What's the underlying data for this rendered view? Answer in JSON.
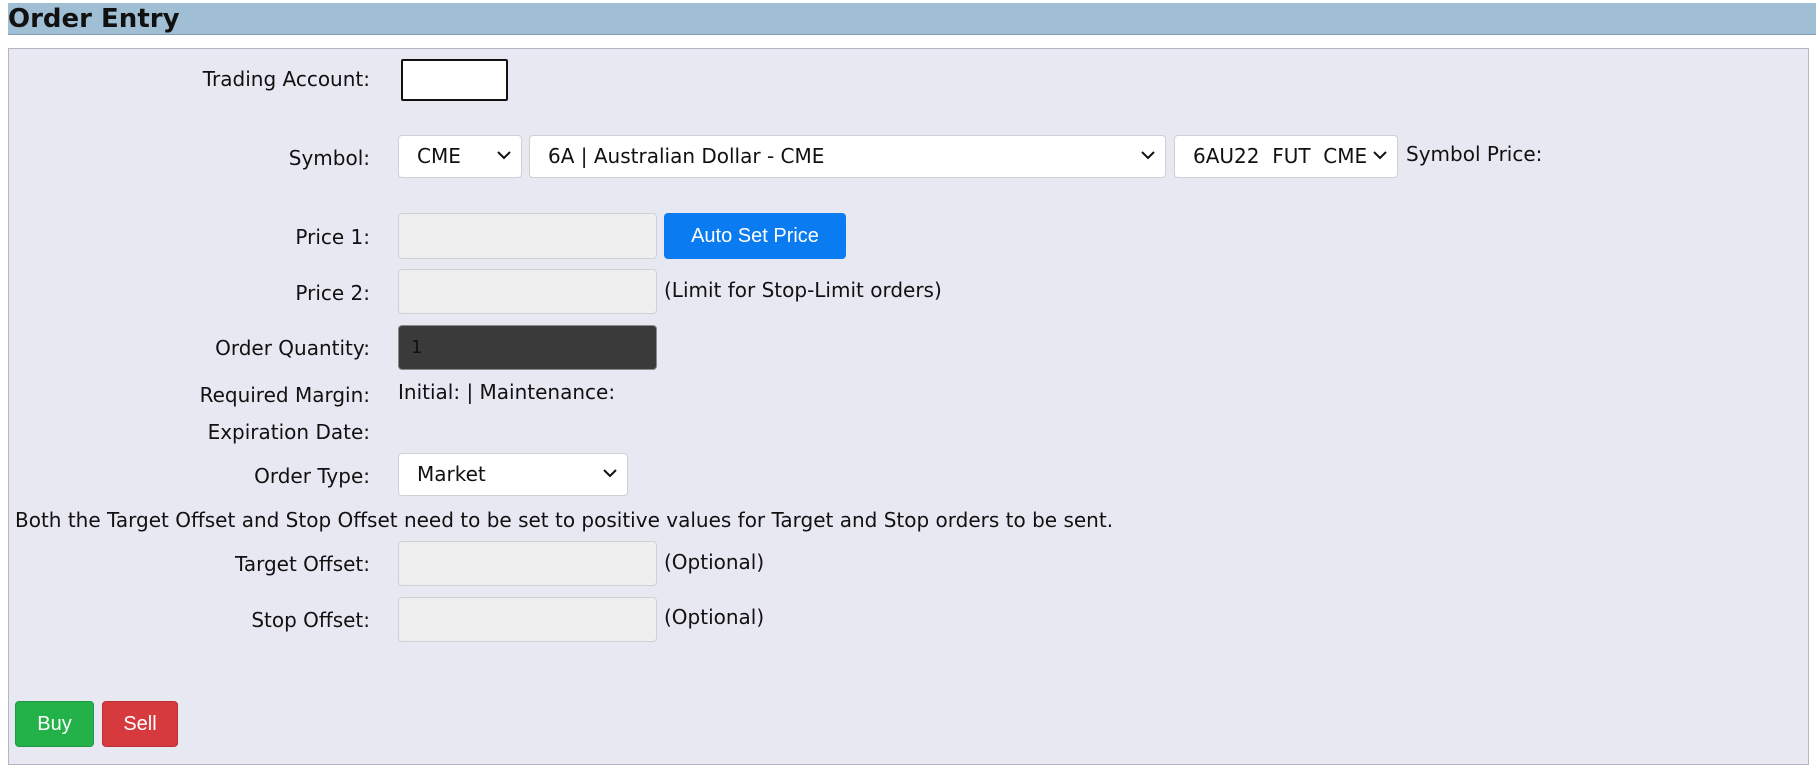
{
  "header": {
    "title": "Order Entry"
  },
  "form": {
    "trading_account": {
      "label": "Trading Account:",
      "value": ""
    },
    "symbol": {
      "label": "Symbol:",
      "exchange": "CME",
      "product": "6A | Australian Dollar - CME",
      "contract": "6AU22  FUT  CME",
      "price_label": "Symbol Price:"
    },
    "price1": {
      "label": "Price 1:",
      "value": "",
      "auto_button": "Auto Set Price"
    },
    "price2": {
      "label": "Price 2:",
      "value": "",
      "note": "(Limit for Stop-Limit orders)"
    },
    "quantity": {
      "label": "Order Quantity:",
      "value": "1"
    },
    "margin": {
      "label": "Required Margin:",
      "value": "Initial: | Maintenance:"
    },
    "expiration": {
      "label": "Expiration Date:"
    },
    "order_type": {
      "label": "Order Type:",
      "value": "Market"
    },
    "offset_notice": "Both the Target Offset and Stop Offset need to be set to positive values for Target and Stop orders to be sent.",
    "target_offset": {
      "label": "Target Offset:",
      "value": "",
      "note": "(Optional)"
    },
    "stop_offset": {
      "label": "Stop Offset:",
      "value": "",
      "note": "(Optional)"
    }
  },
  "actions": {
    "buy": "Buy",
    "sell": "Sell"
  },
  "colors": {
    "header_bg": "#a1bfd4",
    "panel_bg": "#e8e8f2",
    "primary": "#0a7bf0",
    "buy": "#23b24a",
    "sell": "#d63a3e"
  },
  "icons": {
    "dropdown": "chevron-down-icon"
  }
}
